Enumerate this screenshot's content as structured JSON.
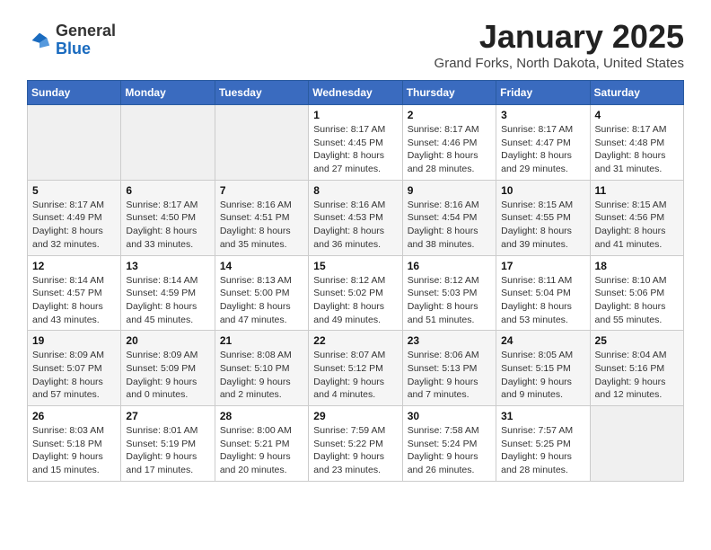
{
  "header": {
    "logo": {
      "general": "General",
      "blue": "Blue"
    },
    "title": "January 2025",
    "location": "Grand Forks, North Dakota, United States"
  },
  "weekdays": [
    "Sunday",
    "Monday",
    "Tuesday",
    "Wednesday",
    "Thursday",
    "Friday",
    "Saturday"
  ],
  "weeks": [
    [
      {
        "day": "",
        "info": ""
      },
      {
        "day": "",
        "info": ""
      },
      {
        "day": "",
        "info": ""
      },
      {
        "day": "1",
        "info": "Sunrise: 8:17 AM\nSunset: 4:45 PM\nDaylight: 8 hours and 27 minutes."
      },
      {
        "day": "2",
        "info": "Sunrise: 8:17 AM\nSunset: 4:46 PM\nDaylight: 8 hours and 28 minutes."
      },
      {
        "day": "3",
        "info": "Sunrise: 8:17 AM\nSunset: 4:47 PM\nDaylight: 8 hours and 29 minutes."
      },
      {
        "day": "4",
        "info": "Sunrise: 8:17 AM\nSunset: 4:48 PM\nDaylight: 8 hours and 31 minutes."
      }
    ],
    [
      {
        "day": "5",
        "info": "Sunrise: 8:17 AM\nSunset: 4:49 PM\nDaylight: 8 hours and 32 minutes."
      },
      {
        "day": "6",
        "info": "Sunrise: 8:17 AM\nSunset: 4:50 PM\nDaylight: 8 hours and 33 minutes."
      },
      {
        "day": "7",
        "info": "Sunrise: 8:16 AM\nSunset: 4:51 PM\nDaylight: 8 hours and 35 minutes."
      },
      {
        "day": "8",
        "info": "Sunrise: 8:16 AM\nSunset: 4:53 PM\nDaylight: 8 hours and 36 minutes."
      },
      {
        "day": "9",
        "info": "Sunrise: 8:16 AM\nSunset: 4:54 PM\nDaylight: 8 hours and 38 minutes."
      },
      {
        "day": "10",
        "info": "Sunrise: 8:15 AM\nSunset: 4:55 PM\nDaylight: 8 hours and 39 minutes."
      },
      {
        "day": "11",
        "info": "Sunrise: 8:15 AM\nSunset: 4:56 PM\nDaylight: 8 hours and 41 minutes."
      }
    ],
    [
      {
        "day": "12",
        "info": "Sunrise: 8:14 AM\nSunset: 4:57 PM\nDaylight: 8 hours and 43 minutes."
      },
      {
        "day": "13",
        "info": "Sunrise: 8:14 AM\nSunset: 4:59 PM\nDaylight: 8 hours and 45 minutes."
      },
      {
        "day": "14",
        "info": "Sunrise: 8:13 AM\nSunset: 5:00 PM\nDaylight: 8 hours and 47 minutes."
      },
      {
        "day": "15",
        "info": "Sunrise: 8:12 AM\nSunset: 5:02 PM\nDaylight: 8 hours and 49 minutes."
      },
      {
        "day": "16",
        "info": "Sunrise: 8:12 AM\nSunset: 5:03 PM\nDaylight: 8 hours and 51 minutes."
      },
      {
        "day": "17",
        "info": "Sunrise: 8:11 AM\nSunset: 5:04 PM\nDaylight: 8 hours and 53 minutes."
      },
      {
        "day": "18",
        "info": "Sunrise: 8:10 AM\nSunset: 5:06 PM\nDaylight: 8 hours and 55 minutes."
      }
    ],
    [
      {
        "day": "19",
        "info": "Sunrise: 8:09 AM\nSunset: 5:07 PM\nDaylight: 8 hours and 57 minutes."
      },
      {
        "day": "20",
        "info": "Sunrise: 8:09 AM\nSunset: 5:09 PM\nDaylight: 9 hours and 0 minutes."
      },
      {
        "day": "21",
        "info": "Sunrise: 8:08 AM\nSunset: 5:10 PM\nDaylight: 9 hours and 2 minutes."
      },
      {
        "day": "22",
        "info": "Sunrise: 8:07 AM\nSunset: 5:12 PM\nDaylight: 9 hours and 4 minutes."
      },
      {
        "day": "23",
        "info": "Sunrise: 8:06 AM\nSunset: 5:13 PM\nDaylight: 9 hours and 7 minutes."
      },
      {
        "day": "24",
        "info": "Sunrise: 8:05 AM\nSunset: 5:15 PM\nDaylight: 9 hours and 9 minutes."
      },
      {
        "day": "25",
        "info": "Sunrise: 8:04 AM\nSunset: 5:16 PM\nDaylight: 9 hours and 12 minutes."
      }
    ],
    [
      {
        "day": "26",
        "info": "Sunrise: 8:03 AM\nSunset: 5:18 PM\nDaylight: 9 hours and 15 minutes."
      },
      {
        "day": "27",
        "info": "Sunrise: 8:01 AM\nSunset: 5:19 PM\nDaylight: 9 hours and 17 minutes."
      },
      {
        "day": "28",
        "info": "Sunrise: 8:00 AM\nSunset: 5:21 PM\nDaylight: 9 hours and 20 minutes."
      },
      {
        "day": "29",
        "info": "Sunrise: 7:59 AM\nSunset: 5:22 PM\nDaylight: 9 hours and 23 minutes."
      },
      {
        "day": "30",
        "info": "Sunrise: 7:58 AM\nSunset: 5:24 PM\nDaylight: 9 hours and 26 minutes."
      },
      {
        "day": "31",
        "info": "Sunrise: 7:57 AM\nSunset: 5:25 PM\nDaylight: 9 hours and 28 minutes."
      },
      {
        "day": "",
        "info": ""
      }
    ]
  ]
}
